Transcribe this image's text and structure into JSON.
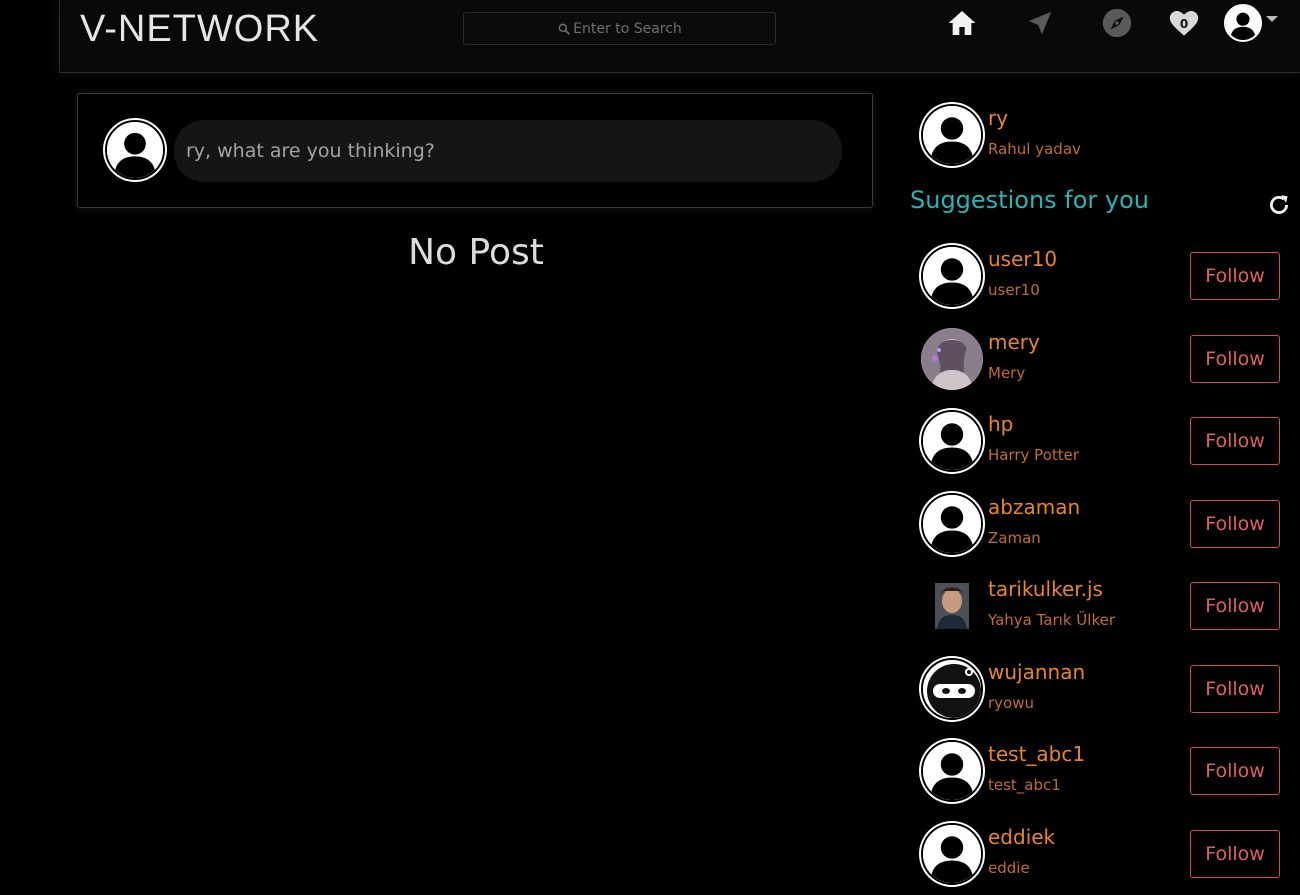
{
  "navbar": {
    "logo": "V-NETWORK",
    "search_placeholder": "Enter to Search",
    "notify_count": "0",
    "icons": [
      "home-icon",
      "send-icon",
      "compass-icon",
      "heart-icon",
      "avatar",
      "chevron-down-icon"
    ]
  },
  "status": {
    "placeholder": "ry, what are you thinking?"
  },
  "feed": {
    "empty_text": "No Post"
  },
  "me": {
    "username": "ry",
    "fullname": "Rahul yadav"
  },
  "suggestions": {
    "title": "Suggestions for you",
    "follow_label": "Follow",
    "items": [
      {
        "username": "user10",
        "fullname": "user10",
        "avatar": "default"
      },
      {
        "username": "mery",
        "fullname": "Mery",
        "avatar": "photo-illustration"
      },
      {
        "username": "hp",
        "fullname": "Harry Potter",
        "avatar": "default"
      },
      {
        "username": "abzaman",
        "fullname": "Zaman",
        "avatar": "default"
      },
      {
        "username": "tarikulker.js",
        "fullname": "Yahya Tarık Ülker",
        "avatar": "photo"
      },
      {
        "username": "wujannan",
        "fullname": "ryowu",
        "avatar": "ninja"
      },
      {
        "username": "test_abc1",
        "fullname": "test_abc1",
        "avatar": "default"
      },
      {
        "username": "eddiek",
        "fullname": "eddie",
        "avatar": "default"
      }
    ]
  },
  "colors": {
    "accent_orange": "#e8862b",
    "accent_teal": "#27b5b5",
    "follow_red": "#d34a48"
  }
}
